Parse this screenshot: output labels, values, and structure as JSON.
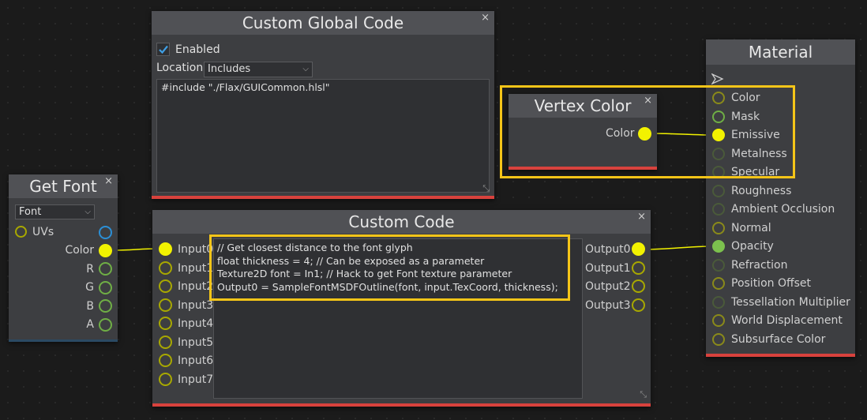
{
  "colors": {
    "accent_yellow": "#f2f200",
    "highlight": "#f5c518",
    "bar_red": "#d8423d",
    "node_bg": "#3d3e41",
    "title_bg": "#505155"
  },
  "custom_global_code": {
    "title": "Custom Global Code",
    "close": "×",
    "enabled_label": "Enabled",
    "enabled_checked": true,
    "location_label": "Location",
    "location_value": "Includes",
    "code": "#include \"./Flax/GUICommon.hlsl\""
  },
  "vertex_color": {
    "title": "Vertex Color",
    "close": "×",
    "output_label": "Color"
  },
  "get_font": {
    "title": "Get Font",
    "close": "×",
    "font_value": "Font",
    "input_label": "UVs",
    "outputs": [
      "Color",
      "R",
      "G",
      "B",
      "A"
    ]
  },
  "custom_code": {
    "title": "Custom Code",
    "close": "×",
    "inputs": [
      "Input0",
      "Input1",
      "Input2",
      "Input3",
      "Input4",
      "Input5",
      "Input6",
      "Input7"
    ],
    "outputs": [
      "Output0",
      "Output1",
      "Output2",
      "Output3"
    ],
    "code": "// Get closest distance to the font glyph\nfloat thickness = 4; // Can be exposed as a parameter\nTexture2D font = In1; // Hack to get Font texture parameter\nOutput0 = SampleFontMSDFOutline(font, input.TexCoord, thickness);"
  },
  "material": {
    "title": "Material",
    "inputs": [
      "Color",
      "Mask",
      "Emissive",
      "Metalness",
      "Specular",
      "Roughness",
      "Ambient Occlusion",
      "Normal",
      "Opacity",
      "Refraction",
      "Position Offset",
      "Tessellation Multiplier",
      "World Displacement",
      "Subsurface Color"
    ]
  }
}
